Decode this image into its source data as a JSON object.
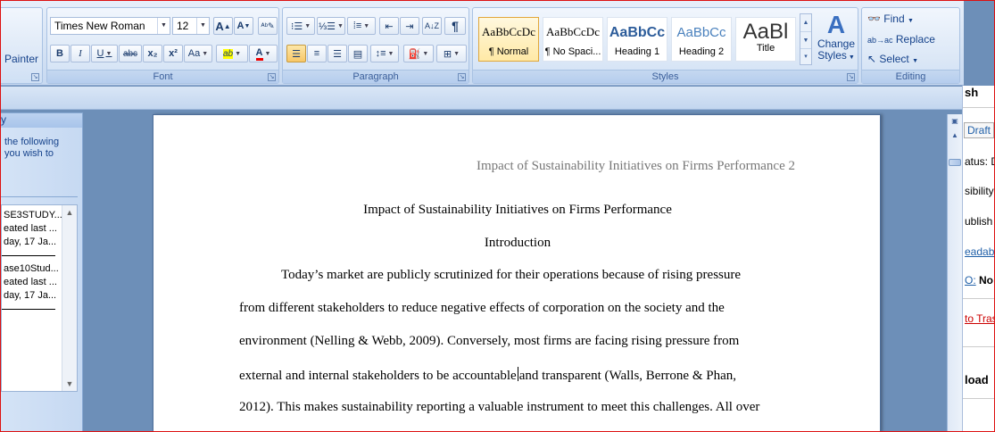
{
  "clipboard": {
    "format_painter_label": "Painter"
  },
  "font_group": {
    "label": "Font",
    "font_name": "Times New Roman",
    "font_size": "12",
    "grow_label": "A",
    "shrink_label": "A",
    "bold": "B",
    "italic": "I",
    "underline": "U",
    "strikethrough": "abc",
    "subscript": "x₂",
    "superscript": "x²",
    "change_case": "Aa",
    "highlight": "ab",
    "font_color": "A"
  },
  "paragraph_group": {
    "label": "Paragraph",
    "pilcrow": "¶"
  },
  "styles_group": {
    "label": "Styles",
    "tiles": [
      {
        "sample": "AaBbCcDc",
        "name": "¶ Normal"
      },
      {
        "sample": "AaBbCcDc",
        "name": "¶ No Spaci..."
      },
      {
        "sample": "AaBbCc",
        "name": "Heading 1"
      },
      {
        "sample": "AaBbCc",
        "name": "Heading 2"
      },
      {
        "sample": "AaBl",
        "name": "Title"
      }
    ],
    "change_styles_line1": "Change",
    "change_styles_line2": "Styles"
  },
  "editing_group": {
    "label": "Editing",
    "find": "Find",
    "replace": "Replace",
    "select": "Select"
  },
  "left_pane": {
    "header": "y",
    "intro_line1": "the following",
    "intro_line2": "you wish to",
    "items": [
      {
        "line1": "SE3STUDY...",
        "line2": "eated last ...",
        "line3": "day, 17 Ja..."
      },
      {
        "line1": "ase10Stud...",
        "line2": "eated last ...",
        "line3": "day, 17 Ja..."
      }
    ]
  },
  "document": {
    "running_header": "Impact of Sustainability Initiatives on Firms Performance 2",
    "title": "Impact of Sustainability Initiatives on Firms Performance",
    "heading": "Introduction",
    "lines": [
      "Today’s market are publicly scrutinized for their operations because of rising pressure",
      "from different stakeholders to reduce negative effects of corporation on the society and the",
      "environment (Nelling & Webb, 2009). Conversely, most firms are facing rising pressure from",
      "external and internal stakeholders to be accountable",
      "and transparent (Walls, Berrone & Phan,",
      "2012). This makes sustainability reporting a valuable instrument to meet this challenges.  All over"
    ]
  },
  "right_pane": {
    "title": "sh",
    "draft": "Draft",
    "status": "atus: D",
    "visibility": "sibility",
    "publish": "ublish (",
    "readability": "eadabi",
    "seo_label": "O:",
    "seo_value": "No",
    "trash": "to Tras",
    "upload": "load"
  }
}
